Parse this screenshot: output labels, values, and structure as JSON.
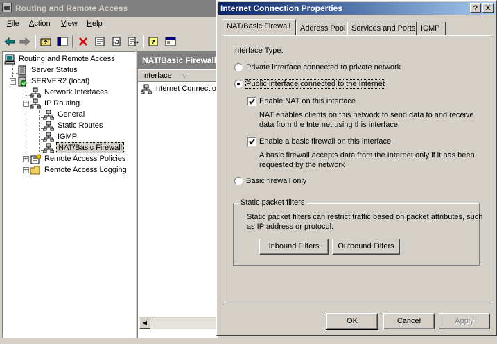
{
  "main": {
    "title": "Routing and Remote Access",
    "menu": [
      {
        "key": "F",
        "rest": "ile"
      },
      {
        "key": "A",
        "rest": "ction"
      },
      {
        "key": "V",
        "rest": "iew"
      },
      {
        "key": "H",
        "rest": "elp"
      }
    ],
    "tree": [
      {
        "label": "Routing and Remote Access",
        "icon": "computer-icon"
      },
      {
        "label": "Server Status",
        "icon": "server-icon"
      },
      {
        "label": "SERVER2 (local)",
        "icon": "server-green-icon"
      },
      {
        "label": "Network Interfaces",
        "icon": "network-icon"
      },
      {
        "label": "IP Routing",
        "icon": "network-icon"
      },
      {
        "label": "General",
        "icon": "network-icon"
      },
      {
        "label": "Static Routes",
        "icon": "network-icon"
      },
      {
        "label": "IGMP",
        "icon": "network-icon"
      },
      {
        "label": "NAT/Basic Firewall",
        "icon": "network-icon"
      },
      {
        "label": "Remote Access Policies",
        "icon": "policy-icon"
      },
      {
        "label": "Remote Access Logging",
        "icon": "folder-icon"
      }
    ],
    "detail": {
      "header": "NAT/Basic Firewall",
      "column": "Interface",
      "row": "Internet Connection"
    }
  },
  "dialog": {
    "title": "Internet Connection Properties",
    "help": "?",
    "close": "X",
    "tabs": [
      "NAT/Basic Firewall",
      "Address Pool",
      "Services and Ports",
      "ICMP"
    ],
    "interface_type_label": "Interface Type:",
    "private_option": "Private interface connected to private network",
    "public_option": "Public interface connected to the Internet",
    "enable_nat": "Enable NAT on this interface",
    "nat_desc_1": "NAT enables clients on this network to send data to and receive",
    "nat_desc_2": "data from the Internet using this interface.",
    "enable_fw": "Enable a basic firewall on this interface",
    "fw_desc_1": "A basic firewall accepts data from the Internet only if it has been",
    "fw_desc_2": "requested by the network",
    "basic_fw_only": "Basic firewall only",
    "static_filters_label": "Static packet filters",
    "static_desc_1": "Static packet filters can restrict traffic based on packet attributes, such",
    "static_desc_2": "as IP address or protocol.",
    "inbound_btn": "Inbound Filters",
    "outbound_btn": "Outbound Filters",
    "ok": "OK",
    "cancel": "Cancel",
    "apply": "Apply",
    "state": {
      "selected_interface": "public",
      "nat_enabled": true,
      "firewall_enabled": true
    }
  }
}
